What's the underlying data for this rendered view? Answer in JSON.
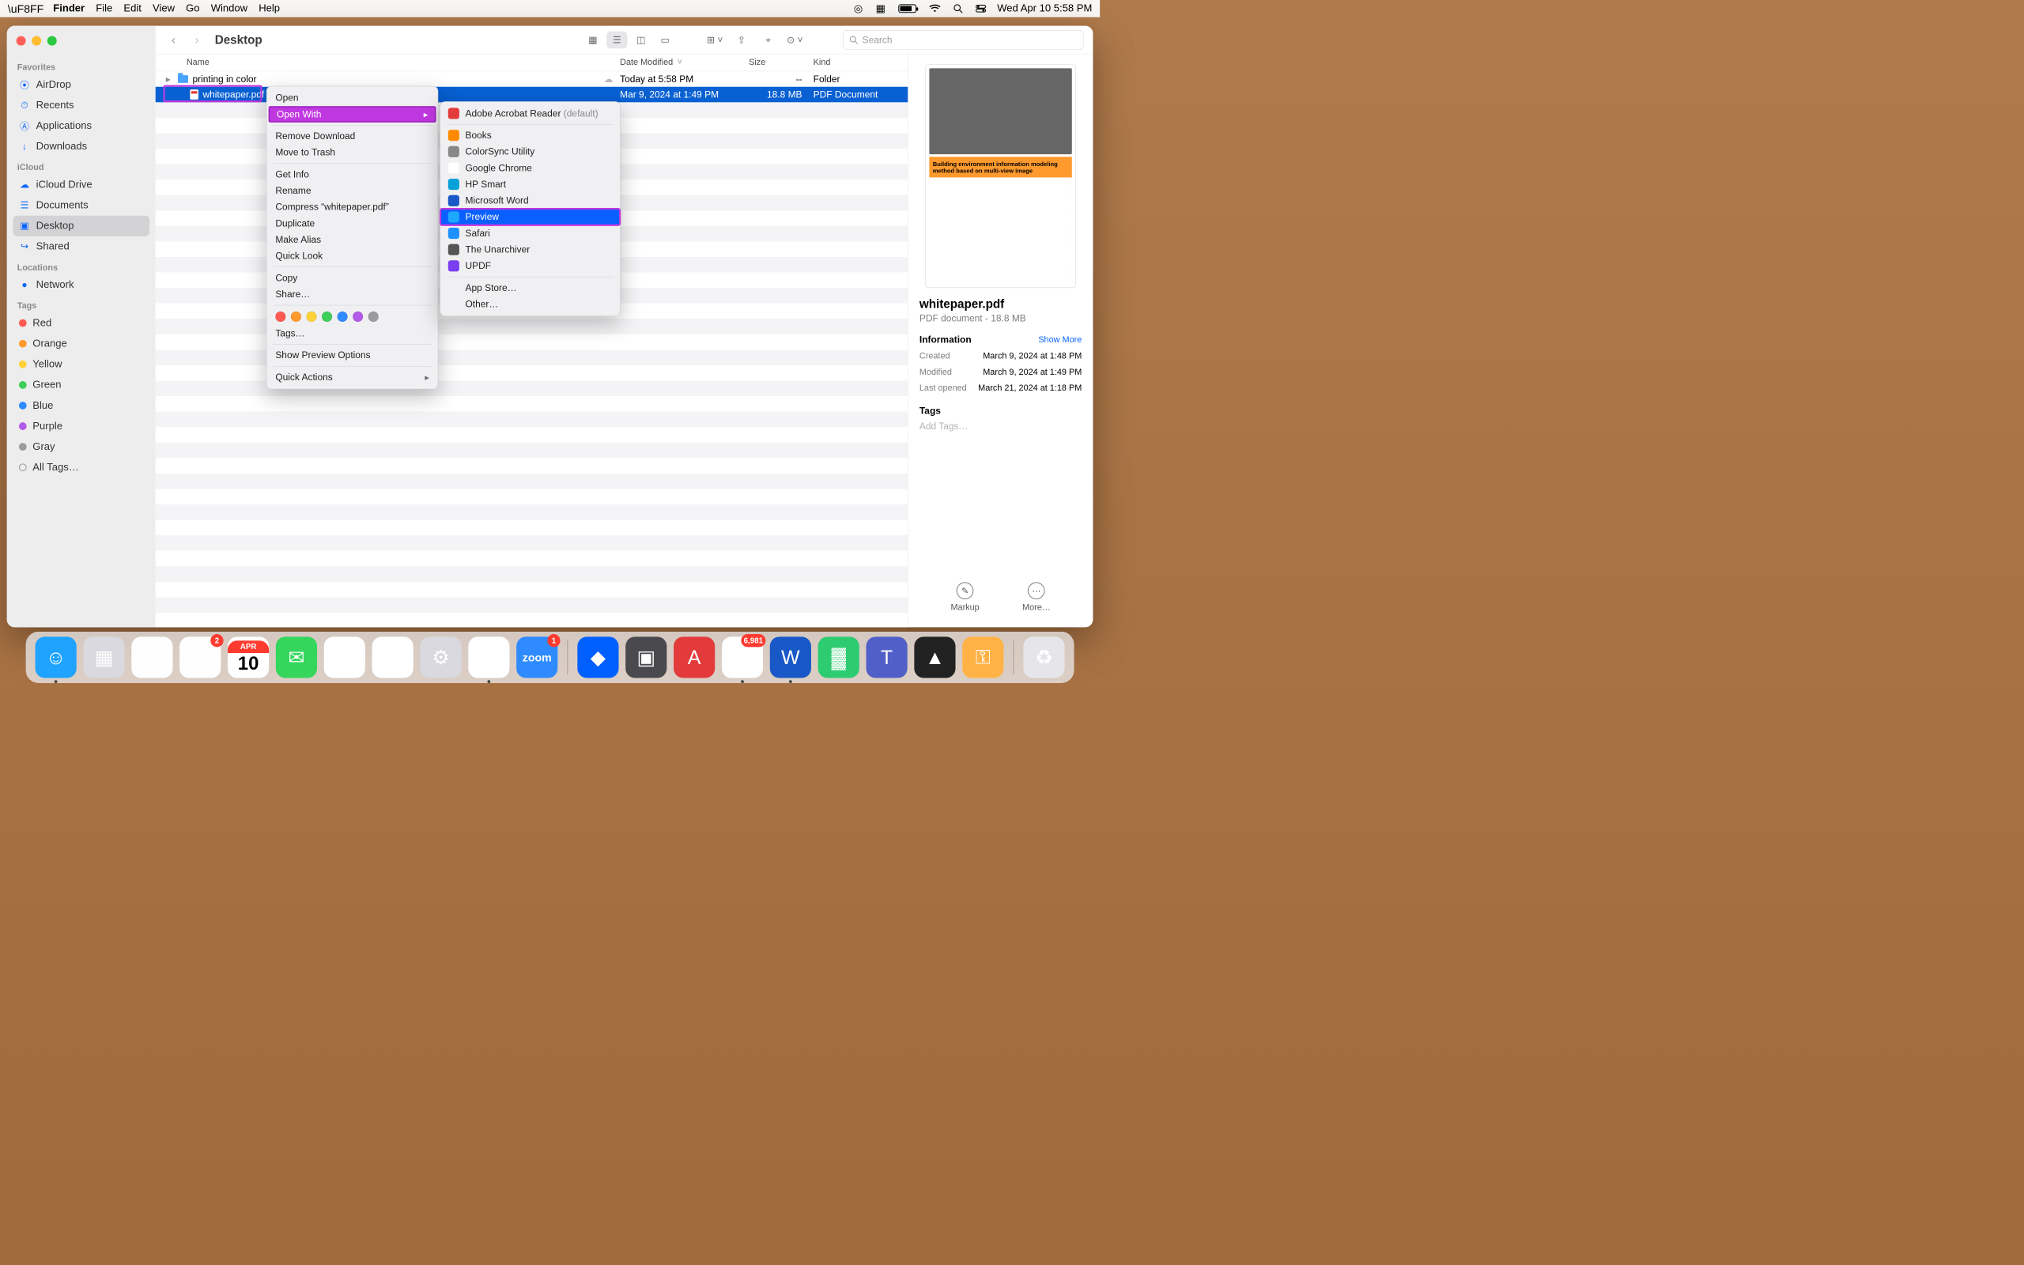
{
  "menubar": {
    "app": "Finder",
    "items": [
      "File",
      "Edit",
      "View",
      "Go",
      "Window",
      "Help"
    ],
    "clock": "Wed Apr 10  5:58 PM"
  },
  "toolbar": {
    "title": "Desktop",
    "search_ph": "Search"
  },
  "columns": {
    "name": "Name",
    "date": "Date Modified",
    "size": "Size",
    "kind": "Kind"
  },
  "rows": [
    {
      "name": "printing in color",
      "date": "Today at 5:58 PM",
      "size": "--",
      "kind": "Folder"
    },
    {
      "name": "whitepaper.pdf",
      "date": "Mar 9, 2024 at 1:49 PM",
      "size": "18.8 MB",
      "kind": "PDF Document"
    }
  ],
  "ctx": {
    "open": "Open",
    "openwith": "Open With",
    "removedl": "Remove Download",
    "trash": "Move to Trash",
    "getinfo": "Get Info",
    "rename": "Rename",
    "compress": "Compress “whitepaper.pdf”",
    "duplicate": "Duplicate",
    "alias": "Make Alias",
    "quicklook": "Quick Look",
    "copy": "Copy",
    "share": "Share…",
    "tags": "Tags…",
    "previewopts": "Show Preview Options",
    "quick": "Quick Actions"
  },
  "openwith": {
    "default_app": "Adobe Acrobat Reader",
    "default_suffix": "(default)",
    "apps": [
      "Books",
      "ColorSync Utility",
      "Google Chrome",
      "HP Smart",
      "Microsoft Word",
      "Preview",
      "Safari",
      "The Unarchiver",
      "UPDF"
    ],
    "appstore": "App Store…",
    "other": "Other…"
  },
  "sidebar": {
    "groups": [
      {
        "head": "Favorites",
        "items": [
          {
            "label": "AirDrop",
            "icon": "⦿"
          },
          {
            "label": "Recents",
            "icon": "⏱"
          },
          {
            "label": "Applications",
            "icon": "Ⓐ"
          },
          {
            "label": "Downloads",
            "icon": "↓"
          }
        ]
      },
      {
        "head": "iCloud",
        "items": [
          {
            "label": "iCloud Drive",
            "icon": "☁"
          },
          {
            "label": "Documents",
            "icon": "☰"
          },
          {
            "label": "Desktop",
            "icon": "▣",
            "active": true
          },
          {
            "label": "Shared",
            "icon": "↪"
          }
        ]
      },
      {
        "head": "Locations",
        "items": [
          {
            "label": "Network",
            "icon": "●"
          }
        ]
      },
      {
        "head": "Tags",
        "items": [
          {
            "label": "Red",
            "color": "#ff5b52"
          },
          {
            "label": "Orange",
            "color": "#ff9a2e"
          },
          {
            "label": "Yellow",
            "color": "#ffd23a"
          },
          {
            "label": "Green",
            "color": "#3dcf5a"
          },
          {
            "label": "Blue",
            "color": "#2f8bff"
          },
          {
            "label": "Purple",
            "color": "#b35be8"
          },
          {
            "label": "Gray",
            "color": "#9b9ba0"
          },
          {
            "label": "All Tags…",
            "color": null
          }
        ]
      }
    ]
  },
  "info": {
    "name": "whitepaper.pdf",
    "sub": "PDF document - 18.8 MB",
    "sec": "Information",
    "showmore": "Show More",
    "kv": [
      {
        "k": "Created",
        "v": "March 9, 2024 at 1:48 PM"
      },
      {
        "k": "Modified",
        "v": "March 9, 2024 at 1:49 PM"
      },
      {
        "k": "Last opened",
        "v": "March 21, 2024 at 1:18 PM"
      }
    ],
    "tagshead": "Tags",
    "addtags": "Add Tags…",
    "thumb_band": "Building environment information modeling method based on multi-view image",
    "act_markup": "Markup",
    "act_more": "More…"
  },
  "dock": {
    "apps": [
      {
        "name": "finder",
        "bg": "#1fa3ff",
        "glyph": "☺",
        "dot": true
      },
      {
        "name": "launchpad",
        "bg": "#d9d9df",
        "glyph": "▦"
      },
      {
        "name": "safari",
        "bg": "#fefefe",
        "glyph": "◎"
      },
      {
        "name": "photos",
        "bg": "#fefefe",
        "glyph": "✿",
        "badge": "2"
      },
      {
        "name": "calendar",
        "cal": {
          "m": "APR",
          "d": "10"
        }
      },
      {
        "name": "messages",
        "bg": "#34d65c",
        "glyph": "✉"
      },
      {
        "name": "notes",
        "bg": "#fff",
        "glyph": "✎"
      },
      {
        "name": "freeform",
        "bg": "#fff",
        "glyph": "∿"
      },
      {
        "name": "settings",
        "bg": "#d9d9df",
        "glyph": "⚙"
      },
      {
        "name": "chrome",
        "bg": "#fff",
        "glyph": "●",
        "dot": true
      },
      {
        "name": "zoom",
        "bg": "#2f8bff",
        "glyph": "zoom",
        "txt": true,
        "badge": "1"
      },
      {
        "name": "sep"
      },
      {
        "name": "dropbox",
        "bg": "#0060ff",
        "glyph": "◆"
      },
      {
        "name": "preview",
        "bg": "#4a4a4e",
        "glyph": "▣"
      },
      {
        "name": "acrobat",
        "bg": "#e33b3b",
        "glyph": "A"
      },
      {
        "name": "mail",
        "bg": "#fff",
        "glyph": "✉",
        "dot": true,
        "badge": "6,981"
      },
      {
        "name": "word",
        "bg": "#1858c7",
        "glyph": "W",
        "dot": true
      },
      {
        "name": "numbers",
        "bg": "#2ecc71",
        "glyph": "▓"
      },
      {
        "name": "teams",
        "bg": "#5060c8",
        "glyph": "T"
      },
      {
        "name": "app1",
        "bg": "#222",
        "glyph": "▲"
      },
      {
        "name": "app2",
        "bg": "#ffb347",
        "glyph": "⚿"
      },
      {
        "name": "sep"
      },
      {
        "name": "trash",
        "bg": "#e6e6ea",
        "glyph": "♻"
      }
    ]
  }
}
